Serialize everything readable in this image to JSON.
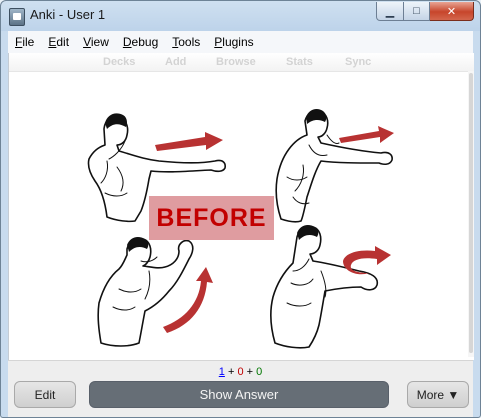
{
  "window": {
    "title": "Anki - User 1"
  },
  "window_buttons": {
    "minimize": "▁",
    "maximize": "□",
    "close": "✕"
  },
  "menu": [
    {
      "key": "F",
      "rest": "ile"
    },
    {
      "key": "E",
      "rest": "dit"
    },
    {
      "key": "V",
      "rest": "iew"
    },
    {
      "key": "D",
      "rest": "ebug"
    },
    {
      "key": "T",
      "rest": "ools"
    },
    {
      "key": "P",
      "rest": "lugins"
    }
  ],
  "toolbar": {
    "decks": "Decks",
    "add": "Add",
    "browse": "Browse",
    "stats": "Stats",
    "sync": "Sync"
  },
  "card": {
    "overlay_text": "BEFORE"
  },
  "counts": {
    "new": "1",
    "sep1": " + ",
    "learn": "0",
    "sep2": " + ",
    "review": "0"
  },
  "buttons": {
    "edit": "Edit",
    "show_answer": "Show Answer",
    "more": "More ▼"
  },
  "colors": {
    "overlay_bg": "#df9ca0",
    "overlay_text": "#c20000",
    "arrow": "#b83232",
    "answer_button": "#666e76"
  },
  "icons": {
    "app": "anki-app-icon",
    "card_images": "boxing-punch-illustrations"
  }
}
